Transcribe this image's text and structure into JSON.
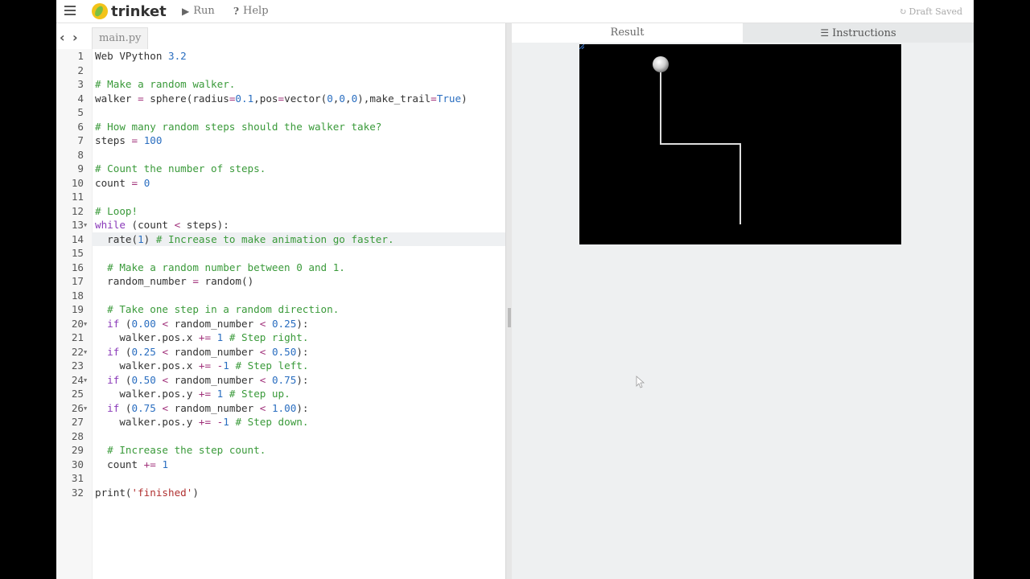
{
  "topbar": {
    "logo_text": "trinket",
    "run_label": "Run",
    "help_label": "Help",
    "status": "Draft Saved"
  },
  "editor": {
    "file_tab": "main.py",
    "active_line": 14,
    "lines": [
      {
        "n": 1,
        "segs": [
          [
            "t",
            "Web VPython "
          ],
          [
            "num",
            "3.2"
          ]
        ]
      },
      {
        "n": 2,
        "segs": []
      },
      {
        "n": 3,
        "segs": [
          [
            "com",
            "# Make a random walker."
          ]
        ]
      },
      {
        "n": 4,
        "segs": [
          [
            "t",
            "walker "
          ],
          [
            "op",
            "="
          ],
          [
            "t",
            " sphere(radius"
          ],
          [
            "op",
            "="
          ],
          [
            "num",
            "0.1"
          ],
          [
            "t",
            ",pos"
          ],
          [
            "op",
            "="
          ],
          [
            "t",
            "vector("
          ],
          [
            "num",
            "0"
          ],
          [
            "t",
            ","
          ],
          [
            "num",
            "0"
          ],
          [
            "t",
            ","
          ],
          [
            "num",
            "0"
          ],
          [
            "t",
            "),make_trail"
          ],
          [
            "op",
            "="
          ],
          [
            "bool",
            "True"
          ],
          [
            "t",
            ")"
          ]
        ]
      },
      {
        "n": 5,
        "segs": []
      },
      {
        "n": 6,
        "segs": [
          [
            "com",
            "# How many random steps should the walker take?"
          ]
        ]
      },
      {
        "n": 7,
        "segs": [
          [
            "t",
            "steps "
          ],
          [
            "op",
            "="
          ],
          [
            "t",
            " "
          ],
          [
            "num",
            "100"
          ]
        ]
      },
      {
        "n": 8,
        "segs": []
      },
      {
        "n": 9,
        "segs": [
          [
            "com",
            "# Count the number of steps."
          ]
        ]
      },
      {
        "n": 10,
        "segs": [
          [
            "t",
            "count "
          ],
          [
            "op",
            "="
          ],
          [
            "t",
            " "
          ],
          [
            "num",
            "0"
          ]
        ]
      },
      {
        "n": 11,
        "segs": []
      },
      {
        "n": 12,
        "segs": [
          [
            "com",
            "# Loop!"
          ]
        ]
      },
      {
        "n": 13,
        "fold": true,
        "segs": [
          [
            "kw",
            "while"
          ],
          [
            "t",
            " (count "
          ],
          [
            "op",
            "<"
          ],
          [
            "t",
            " steps):"
          ]
        ]
      },
      {
        "n": 14,
        "segs": [
          [
            "t",
            "  rate("
          ],
          [
            "num",
            "1"
          ],
          [
            "t",
            ") "
          ],
          [
            "com",
            "# Increase to make animation go faster."
          ]
        ]
      },
      {
        "n": 15,
        "segs": []
      },
      {
        "n": 16,
        "segs": [
          [
            "t",
            "  "
          ],
          [
            "com",
            "# Make a random number between 0 and 1."
          ]
        ]
      },
      {
        "n": 17,
        "segs": [
          [
            "t",
            "  random_number "
          ],
          [
            "op",
            "="
          ],
          [
            "t",
            " random()"
          ]
        ]
      },
      {
        "n": 18,
        "segs": []
      },
      {
        "n": 19,
        "segs": [
          [
            "t",
            "  "
          ],
          [
            "com",
            "# Take one step in a random direction."
          ]
        ]
      },
      {
        "n": 20,
        "fold": true,
        "segs": [
          [
            "t",
            "  "
          ],
          [
            "kw",
            "if"
          ],
          [
            "t",
            " ("
          ],
          [
            "num",
            "0.00"
          ],
          [
            "t",
            " "
          ],
          [
            "op",
            "<"
          ],
          [
            "t",
            " random_number "
          ],
          [
            "op",
            "<"
          ],
          [
            "t",
            " "
          ],
          [
            "num",
            "0.25"
          ],
          [
            "t",
            "):"
          ]
        ]
      },
      {
        "n": 21,
        "segs": [
          [
            "t",
            "    walker.pos.x "
          ],
          [
            "op",
            "+="
          ],
          [
            "t",
            " "
          ],
          [
            "num",
            "1"
          ],
          [
            "t",
            " "
          ],
          [
            "com",
            "# Step right."
          ]
        ]
      },
      {
        "n": 22,
        "fold": true,
        "segs": [
          [
            "t",
            "  "
          ],
          [
            "kw",
            "if"
          ],
          [
            "t",
            " ("
          ],
          [
            "num",
            "0.25"
          ],
          [
            "t",
            " "
          ],
          [
            "op",
            "<"
          ],
          [
            "t",
            " random_number "
          ],
          [
            "op",
            "<"
          ],
          [
            "t",
            " "
          ],
          [
            "num",
            "0.50"
          ],
          [
            "t",
            "):"
          ]
        ]
      },
      {
        "n": 23,
        "segs": [
          [
            "t",
            "    walker.pos.x "
          ],
          [
            "op",
            "+="
          ],
          [
            "t",
            " "
          ],
          [
            "op",
            "-"
          ],
          [
            "num",
            "1"
          ],
          [
            "t",
            " "
          ],
          [
            "com",
            "# Step left."
          ]
        ]
      },
      {
        "n": 24,
        "fold": true,
        "segs": [
          [
            "t",
            "  "
          ],
          [
            "kw",
            "if"
          ],
          [
            "t",
            " ("
          ],
          [
            "num",
            "0.50"
          ],
          [
            "t",
            " "
          ],
          [
            "op",
            "<"
          ],
          [
            "t",
            " random_number "
          ],
          [
            "op",
            "<"
          ],
          [
            "t",
            " "
          ],
          [
            "num",
            "0.75"
          ],
          [
            "t",
            "):"
          ]
        ]
      },
      {
        "n": 25,
        "segs": [
          [
            "t",
            "    walker.pos.y "
          ],
          [
            "op",
            "+="
          ],
          [
            "t",
            " "
          ],
          [
            "num",
            "1"
          ],
          [
            "t",
            " "
          ],
          [
            "com",
            "# Step up."
          ]
        ]
      },
      {
        "n": 26,
        "fold": true,
        "segs": [
          [
            "t",
            "  "
          ],
          [
            "kw",
            "if"
          ],
          [
            "t",
            " ("
          ],
          [
            "num",
            "0.75"
          ],
          [
            "t",
            " "
          ],
          [
            "op",
            "<"
          ],
          [
            "t",
            " random_number "
          ],
          [
            "op",
            "<"
          ],
          [
            "t",
            " "
          ],
          [
            "num",
            "1.00"
          ],
          [
            "t",
            "):"
          ]
        ]
      },
      {
        "n": 27,
        "segs": [
          [
            "t",
            "    walker.pos.y "
          ],
          [
            "op",
            "+="
          ],
          [
            "t",
            " "
          ],
          [
            "op",
            "-"
          ],
          [
            "num",
            "1"
          ],
          [
            "t",
            " "
          ],
          [
            "com",
            "# Step down."
          ]
        ]
      },
      {
        "n": 28,
        "segs": []
      },
      {
        "n": 29,
        "segs": [
          [
            "t",
            "  "
          ],
          [
            "com",
            "# Increase the step count."
          ]
        ]
      },
      {
        "n": 30,
        "segs": [
          [
            "t",
            "  count "
          ],
          [
            "op",
            "+="
          ],
          [
            "t",
            " "
          ],
          [
            "num",
            "1"
          ]
        ]
      },
      {
        "n": 31,
        "segs": []
      },
      {
        "n": 32,
        "segs": [
          [
            "t",
            "print("
          ],
          [
            "str",
            "'finished'"
          ],
          [
            "t",
            ")"
          ]
        ]
      }
    ]
  },
  "output": {
    "tab_result": "Result",
    "tab_instructions": "Instructions"
  },
  "colors": {
    "comment": "#3a9a3a",
    "keyword": "#8a3ab9",
    "number": "#2a6ec0",
    "string": "#b03030",
    "canvas_bg": "#000000",
    "trail": "#dddddd"
  },
  "icons": {
    "menu": "hamburger-icon",
    "run": "play-icon",
    "help": "question-icon",
    "status": "refresh-icon",
    "instructions": "list-icon"
  }
}
